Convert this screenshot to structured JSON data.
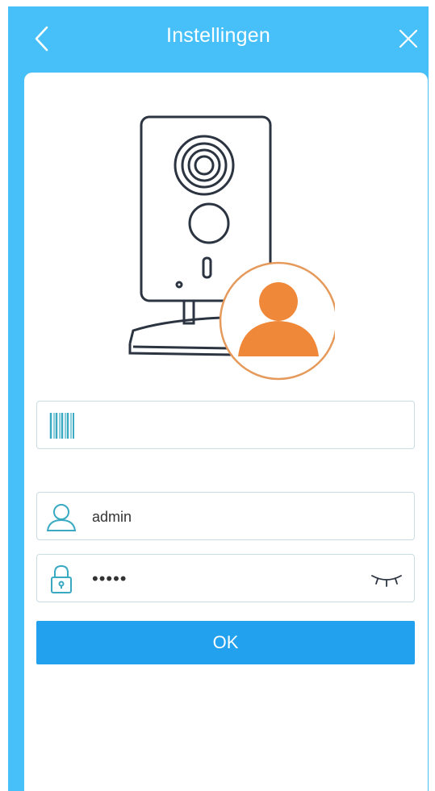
{
  "header": {
    "title": "Instellingen",
    "back_icon": "chevron-left-icon",
    "close_icon": "close-icon"
  },
  "form": {
    "serial_field": {
      "value": "",
      "icon": "barcode-icon"
    },
    "username_field": {
      "value": "admin",
      "icon": "user-icon"
    },
    "password_field": {
      "value": "12345",
      "icon": "lock-icon",
      "toggle_icon": "eye-closed-icon"
    },
    "ok_label": "OK"
  },
  "colors": {
    "header_bg": "#47c0f9",
    "primary_button": "#22a1ee",
    "accent_orange": "#f0883a",
    "field_border": "#c9dde3",
    "icon_teal": "#3aa9c2"
  }
}
